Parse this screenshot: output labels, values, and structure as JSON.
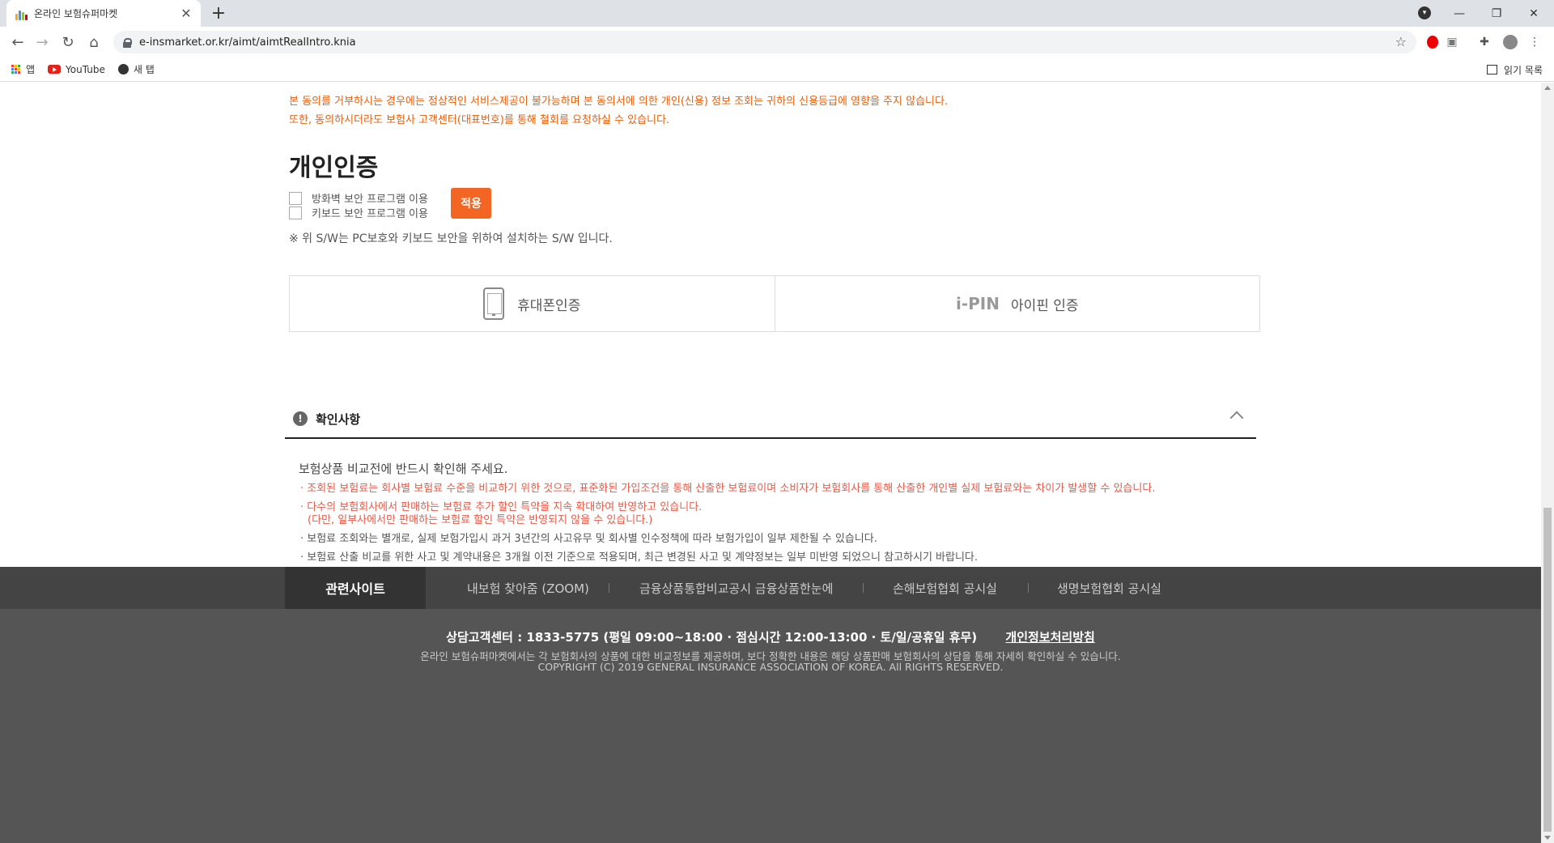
{
  "browser": {
    "tab_title": "온라인 보험슈퍼마켓",
    "url": "e-insmarket.or.kr/aimt/aimtRealIntro.knia",
    "bookmarks": [
      {
        "label": "앱",
        "icon": "apps-grid-icon"
      },
      {
        "label": "YouTube",
        "icon": "youtube-icon"
      },
      {
        "label": "새 탭",
        "icon": "globe-icon"
      }
    ],
    "reading_list": "읽기 목록"
  },
  "consent": {
    "line1": "본 동의를 거부하시는 경우에는 정상적인 서비스제공이 불가능하며 본 동의서에 의한 개인(신용) 정보 조회는 귀하의 신용등급에 영향을 주지 않습니다.",
    "line2": "또한, 동의하시더라도 보험사 고객센터(대표번호)를 통해 철회를 요청하실 수 있습니다."
  },
  "auth": {
    "title": "개인인증",
    "firewall_label": "방화벽 보안 프로그램 이용",
    "keyboard_label": "키보드 보안 프로그램 이용",
    "apply_label": "적용",
    "sw_note": "※ 위 S/W는 PC보호와 키보드 보안을 위하여 설치하는 S/W 입니다.",
    "phone_label": "휴대폰인증",
    "ipin_logo_i": "i",
    "ipin_logo_rest": "-PIN",
    "ipin_label": "아이핀 인증"
  },
  "confirm": {
    "title": "확인사항",
    "lead": "보험상품 비교전에 반드시 확인해 주세요.",
    "bullets": [
      "· 조회된 보험료는 회사별 보험료 수준을 비교하기 위한 것으로, 표준화된 가입조건을 통해 산출한 보험료이며 소비자가 보험회사를 통해 산출한 개인별 실제 보험료와는 차이가 발생할 수 있습니다.",
      "· 다수의 보험회사에서 판매하는 보험료 추가 할인 특약을 지속 확대하여 반영하고 있습니다.",
      "(다만, 일부사에서만 판매하는 보험료 할인 특약은 반영되지 않을 수 있습니다.)",
      "· 보험료 조회와는 별개로, 실제 보험가입시 과거 3년간의 사고유무 및 회사별 인수정책에 따라 보험가입이 일부 제한될 수 있습니다.",
      "· 보험료 산출 비교를 위한 사고 및 계약내용은 3개월 이전 기준으로 적용되며, 최근 변경된 사고 및 계약정보는 일부 미반영 되었으니 참고하시기 바랍니다."
    ]
  },
  "footer": {
    "related_sites": "관련사이트",
    "links": [
      "내보험 찾아줌 (ZOOM)",
      "금융상품통합비교공시 금융상품한눈에",
      "손해보험협회 공시실",
      "생명보험협회 공시실"
    ],
    "contact": "상담고객센터 : 1833-5775 (평일 09:00~18:00  ·  점심시간 12:00-13:00  ·  토/일/공휴일 휴무)",
    "privacy": "개인정보처리방침",
    "disclaimer": "온라인 보험슈퍼마켓에서는 각 보험회사의 상품에 대한 비교정보를 제공하며, 보다 정확한 내용은 해당 상품판매 보험회사의 상담을 통해 자세히 확인하실 수 있습니다.",
    "copyright": "COPYRIGHT (C) 2019 GENERAL INSURANCE ASSOCIATION OF KOREA. All RIGHTS RESERVED."
  },
  "colors": {
    "accent": "#f26522",
    "notice_text": "#e8600c",
    "bullet_red": "#e85a48"
  }
}
